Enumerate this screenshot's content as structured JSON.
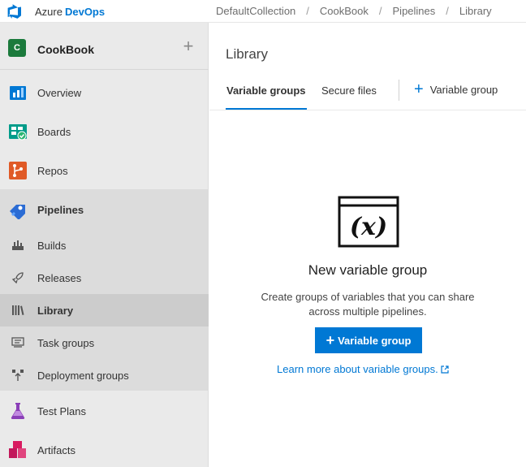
{
  "header": {
    "brand_prefix": "Azure",
    "brand_name": "DevOps",
    "breadcrumbs": [
      "DefaultCollection",
      "CookBook",
      "Pipelines",
      "Library"
    ],
    "brand_color": "#0078d4"
  },
  "sidebar": {
    "project": {
      "avatar_letter": "C",
      "name": "CookBook",
      "add_symbol": "+"
    },
    "items": [
      {
        "label": "Overview",
        "icon": "overview-icon"
      },
      {
        "label": "Boards",
        "icon": "boards-icon"
      },
      {
        "label": "Repos",
        "icon": "repos-icon"
      },
      {
        "label": "Pipelines",
        "icon": "pipelines-icon"
      },
      {
        "label": "Builds",
        "icon": "builds-icon"
      },
      {
        "label": "Releases",
        "icon": "releases-icon"
      },
      {
        "label": "Library",
        "icon": "library-icon",
        "selected": true
      },
      {
        "label": "Task groups",
        "icon": "task-groups-icon"
      },
      {
        "label": "Deployment groups",
        "icon": "deployment-groups-icon"
      },
      {
        "label": "Test Plans",
        "icon": "test-plans-icon"
      },
      {
        "label": "Artifacts",
        "icon": "artifacts-icon"
      }
    ]
  },
  "main": {
    "title": "Library",
    "tabs": [
      {
        "label": "Variable groups",
        "active": true
      },
      {
        "label": "Secure files",
        "active": false
      }
    ],
    "add_action": {
      "symbol": "+",
      "label": "Variable group"
    },
    "empty_state": {
      "icon": "variable-icon",
      "icon_text": "(x)",
      "title": "New variable group",
      "description": "Create groups of variables that you can share across multiple pipelines.",
      "button_symbol": "+",
      "button_label": "Variable group",
      "link_text": "Learn more about variable groups."
    }
  }
}
